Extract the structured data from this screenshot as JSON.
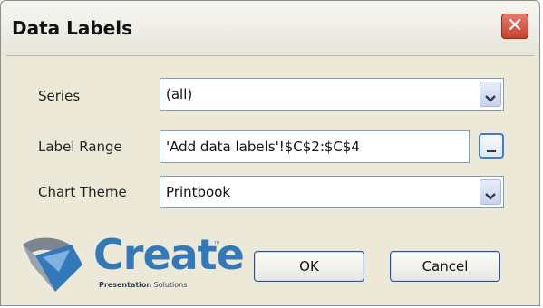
{
  "dialog": {
    "title": "Data Labels",
    "close_icon": "close-icon"
  },
  "form": {
    "series_label": "Series",
    "series_value": "(all)",
    "label_range_label": "Label Range",
    "label_range_value": "'Add data labels'!$C$2:$C$4",
    "chart_theme_label": "Chart Theme",
    "chart_theme_value": "Printbook"
  },
  "buttons": {
    "ok": "OK",
    "cancel": "Cancel"
  },
  "logo": {
    "word": "Create",
    "tm": "™",
    "sub_bold": "Presentation",
    "sub_rest": "Solutions"
  },
  "colors": {
    "accent": "#3378b8",
    "close": "#c8412d"
  }
}
